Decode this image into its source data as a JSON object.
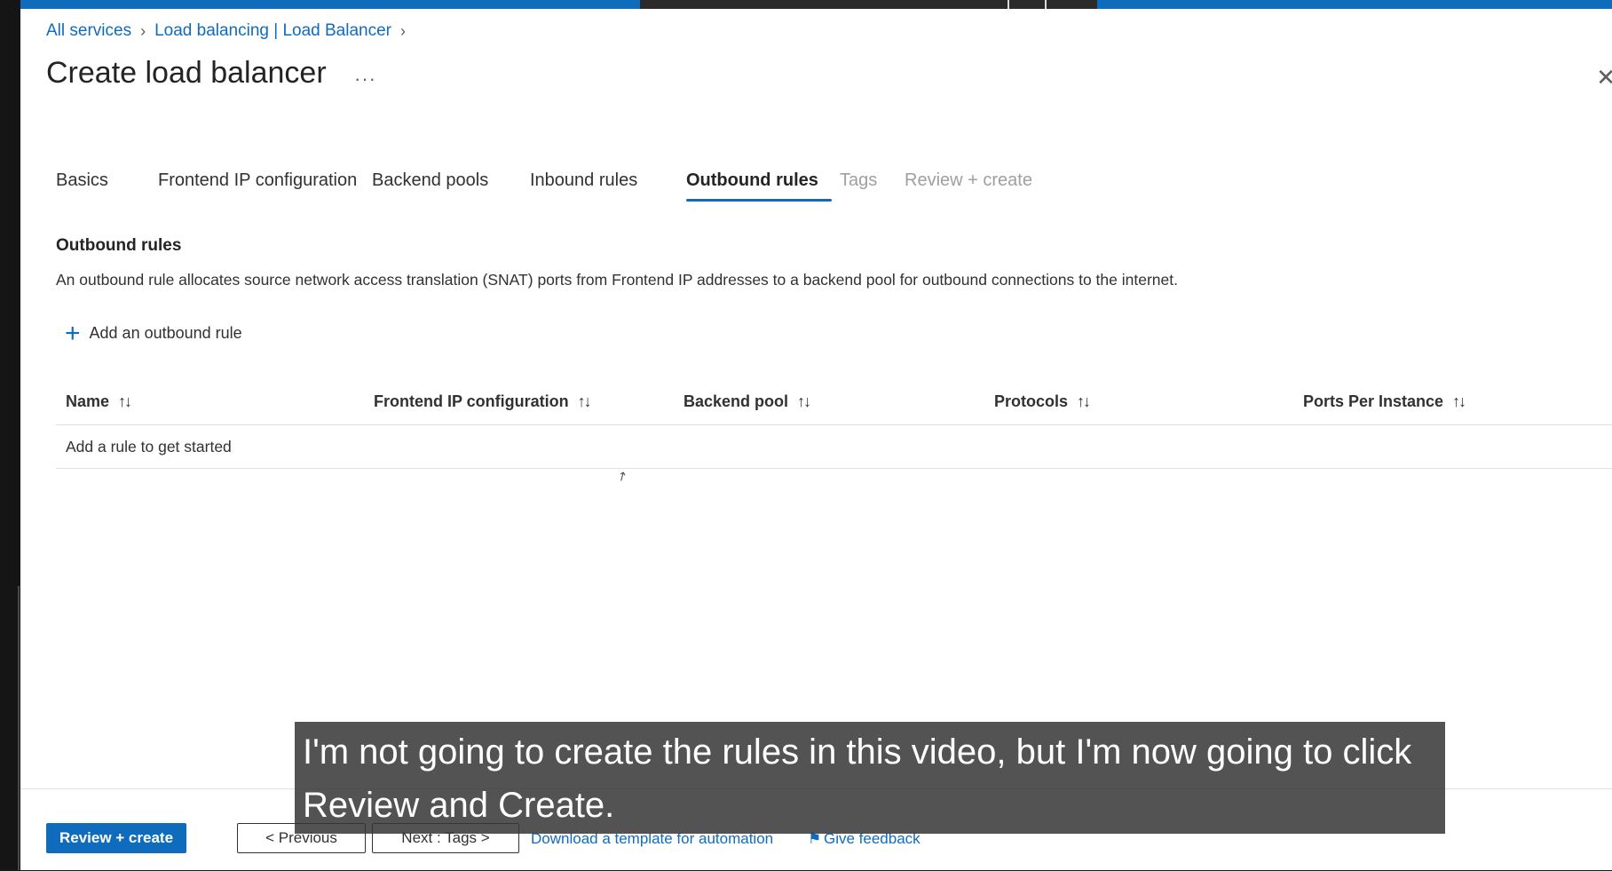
{
  "breadcrumb": {
    "items": [
      "All services",
      "Load balancing | Load Balancer"
    ]
  },
  "page": {
    "title": "Create load balancer",
    "more_label": "···"
  },
  "tabs": [
    {
      "label": "Basics",
      "state": "normal"
    },
    {
      "label": "Frontend IP configuration",
      "state": "normal"
    },
    {
      "label": "Backend pools",
      "state": "normal"
    },
    {
      "label": "Inbound rules",
      "state": "normal"
    },
    {
      "label": "Outbound rules",
      "state": "active"
    },
    {
      "label": "Tags",
      "state": "disabled"
    },
    {
      "label": "Review + create",
      "state": "disabled"
    }
  ],
  "section": {
    "title": "Outbound rules",
    "description": "An outbound rule allocates source network access translation (SNAT) ports from Frontend IP addresses to a backend pool for outbound connections to the internet."
  },
  "add_rule": {
    "label": "Add an outbound rule"
  },
  "table": {
    "columns": [
      "Name",
      "Frontend IP configuration",
      "Backend pool",
      "Protocols",
      "Ports Per Instance"
    ],
    "sort_glyph": "↑↓",
    "empty_message": "Add a rule to get started"
  },
  "footer": {
    "review_create": "Review + create",
    "previous": "< Previous",
    "next": "Next : Tags >",
    "download_link": "Download a template for automation",
    "feedback_link": "Give feedback"
  },
  "caption": {
    "text": "I'm not going to create the rules in this video, but I'm now going to click Review and Create."
  },
  "colors": {
    "accent": "#0f6cbd",
    "text": "#323130",
    "disabled": "#a19f9d"
  }
}
